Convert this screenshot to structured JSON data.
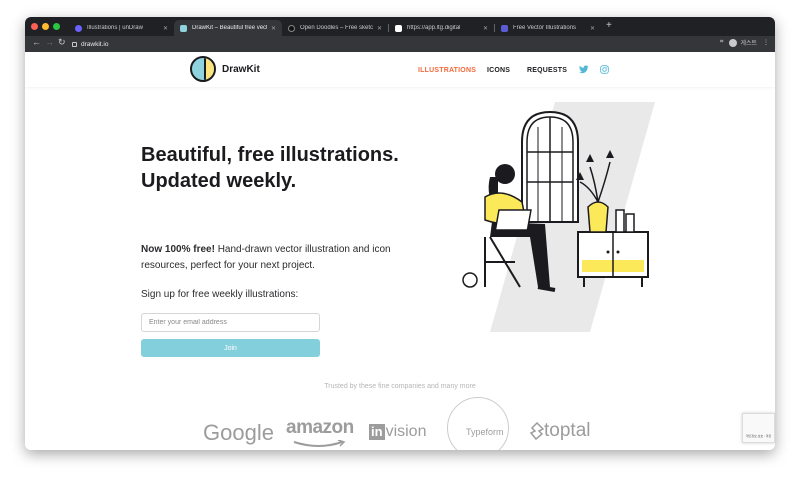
{
  "browser": {
    "tabs": [
      {
        "title": "Illustrations | unDraw",
        "favicon_color": "#6c63ff",
        "active": false
      },
      {
        "title": "DrawKit – Beautiful free vector",
        "favicon_color": "#8fd3df",
        "active": true
      },
      {
        "title": "Open Doodles – Free sketchy I",
        "favicon_color": "#111111",
        "active": false
      },
      {
        "title": "https://app.ltg.digital",
        "favicon_color": "#ffffff",
        "active": false
      },
      {
        "title": "Free Vector Illustrations",
        "favicon_color": "#5b5bd6",
        "active": false
      }
    ],
    "url": "drawkit.io",
    "profile_label": "게스트"
  },
  "site": {
    "logo_text": "DrawKit",
    "nav": [
      {
        "label": "ILLUSTRATIONS",
        "active": true
      },
      {
        "label": "ICONS",
        "active": false
      },
      {
        "label": "REQUESTS",
        "active": false
      }
    ],
    "social": [
      "twitter-icon",
      "instagram-icon"
    ],
    "accent_color": "#f06b3c",
    "brand_teal": "#84cfdc",
    "brand_yellow": "#fbe37d"
  },
  "hero": {
    "title": "Beautiful, free illustrations. Updated weekly.",
    "desc_bold": "Now 100% free!",
    "desc_rest": " Hand-drawn vector illustration and icon resources, perfect for your next project.",
    "signup_label": "Sign up for free weekly illustrations:",
    "email_placeholder": "Enter your email address",
    "join_label": "Join"
  },
  "companies": {
    "caption": "Trusted by these fine companies and many more",
    "google": "Google",
    "amazon": "amazon",
    "invision_box": "in",
    "invision_rest": "vision",
    "typeform": "Typeform",
    "toptal": "toptal"
  },
  "recaptcha": {
    "text": "개인정보 보호 - 약관"
  }
}
